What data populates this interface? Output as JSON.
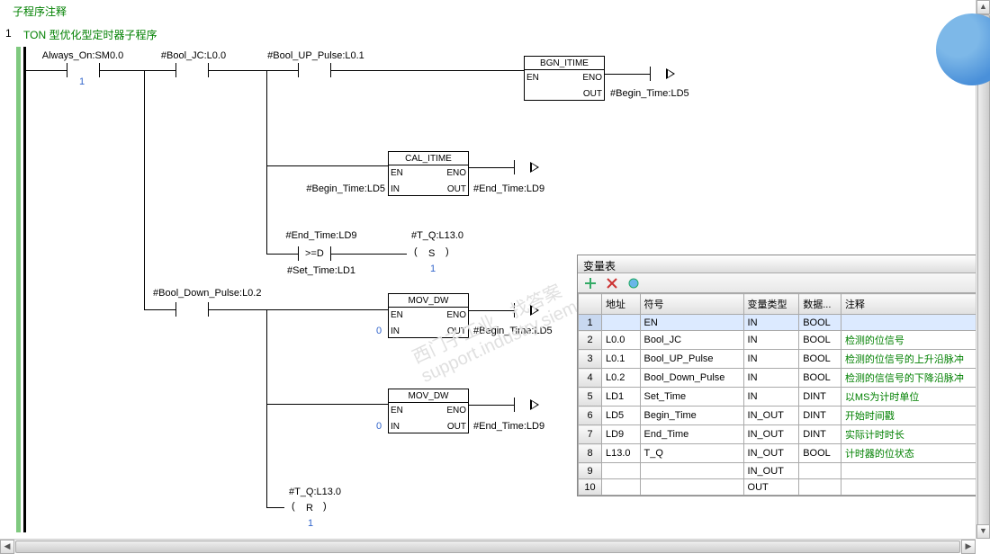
{
  "header_comment": "子程序注释",
  "net_number": "1",
  "sub_comment": "TON 型优化型定时器子程序",
  "contacts": {
    "always_on": "Always_On:SM0.0",
    "bool_jc": "#Bool_JC:L0.0",
    "bool_up_pulse": "#Bool_UP_Pulse:L0.1",
    "bool_down_pulse": "#Bool_Down_Pulse:L0.2"
  },
  "blocks": {
    "bgn_itime": {
      "title": "BGN_ITIME",
      "en": "EN",
      "eno": "ENO",
      "out": "OUT",
      "out_val": "#Begin_Time:LD5"
    },
    "cal_itime": {
      "title": "CAL_ITIME",
      "en": "EN",
      "eno": "ENO",
      "in": "IN",
      "out": "OUT",
      "in_val": "#Begin_Time:LD5",
      "out_val": "#End_Time:LD9"
    },
    "compare": {
      "top": "#End_Time:LD9",
      "op": ">=D",
      "bot": "#Set_Time:LD1"
    },
    "coil_s": {
      "label": "#T_Q:L13.0",
      "type": "S",
      "count": "1"
    },
    "mov1": {
      "title": "MOV_DW",
      "en": "EN",
      "eno": "ENO",
      "in": "IN",
      "out": "OUT",
      "in_val": "0",
      "out_val": "#Begin_Time:LD5"
    },
    "mov2": {
      "title": "MOV_DW",
      "en": "EN",
      "eno": "ENO",
      "in": "IN",
      "out": "OUT",
      "in_val": "0",
      "out_val": "#End_Time:LD9"
    },
    "coil_r": {
      "label": "#T_Q:L13.0",
      "type": "R",
      "count": "1"
    }
  },
  "one_glyph": "1",
  "vartable": {
    "title": "变量表",
    "headers": {
      "addr": "地址",
      "symbol": "符号",
      "vartype": "变量类型",
      "datatype": "数据...",
      "comment": "注释"
    },
    "rows": [
      {
        "n": "1",
        "addr": "",
        "sym": "EN",
        "vt": "IN",
        "dt": "BOOL",
        "c": ""
      },
      {
        "n": "2",
        "addr": "L0.0",
        "sym": "Bool_JC",
        "vt": "IN",
        "dt": "BOOL",
        "c": "检测的位信号"
      },
      {
        "n": "3",
        "addr": "L0.1",
        "sym": "Bool_UP_Pulse",
        "vt": "IN",
        "dt": "BOOL",
        "c": "检测的位信号的上升沿脉冲"
      },
      {
        "n": "4",
        "addr": "L0.2",
        "sym": "Bool_Down_Pulse",
        "vt": "IN",
        "dt": "BOOL",
        "c": "检测的信信号的下降沿脉冲"
      },
      {
        "n": "5",
        "addr": "LD1",
        "sym": "Set_Time",
        "vt": "IN",
        "dt": "DINT",
        "c": "以MS为计时单位"
      },
      {
        "n": "6",
        "addr": "LD5",
        "sym": "Begin_Time",
        "vt": "IN_OUT",
        "dt": "DINT",
        "c": "开始时间戳"
      },
      {
        "n": "7",
        "addr": "LD9",
        "sym": "End_Time",
        "vt": "IN_OUT",
        "dt": "DINT",
        "c": "实际计时时长"
      },
      {
        "n": "8",
        "addr": "L13.0",
        "sym": "T_Q",
        "vt": "IN_OUT",
        "dt": "BOOL",
        "c": "计时器的位状态"
      },
      {
        "n": "9",
        "addr": "",
        "sym": "",
        "vt": "IN_OUT",
        "dt": "",
        "c": ""
      },
      {
        "n": "10",
        "addr": "",
        "sym": "",
        "vt": "OUT",
        "dt": "",
        "c": ""
      }
    ]
  }
}
